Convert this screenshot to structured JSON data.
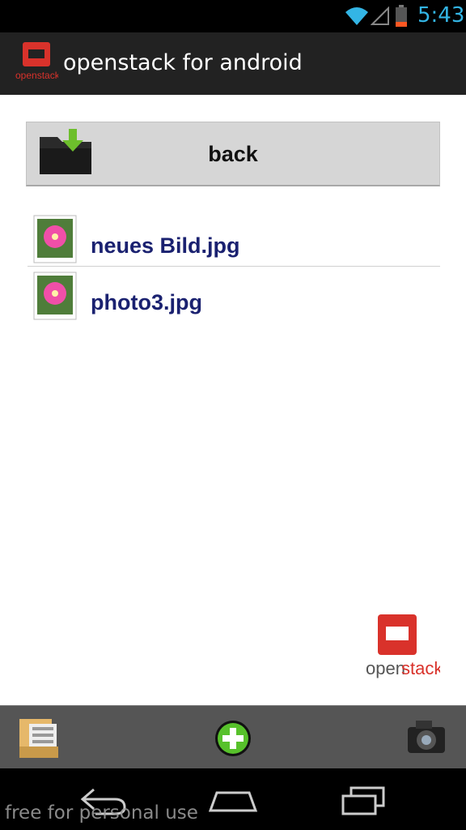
{
  "status_bar": {
    "time": "5:43"
  },
  "action_bar": {
    "title": "openstack for android",
    "logo_text": "openstack"
  },
  "back_button": {
    "label": "back"
  },
  "files": [
    {
      "name": "neues Bild.jpg",
      "icon": "photo-file-icon"
    },
    {
      "name": "photo3.jpg",
      "icon": "photo-file-icon"
    }
  ],
  "brand_logo": {
    "text_open": "open",
    "text_stack": "stack"
  },
  "toolbar": {
    "items": [
      "folder-icon",
      "add-icon",
      "camera-icon"
    ]
  },
  "navigation": {
    "items": [
      "back-icon",
      "home-icon",
      "recents-icon"
    ]
  },
  "watermark": "free for personal use",
  "colors": {
    "accent_blue": "#33b5e5",
    "file_text": "#1a2170",
    "openstack_red": "#d9322b"
  }
}
